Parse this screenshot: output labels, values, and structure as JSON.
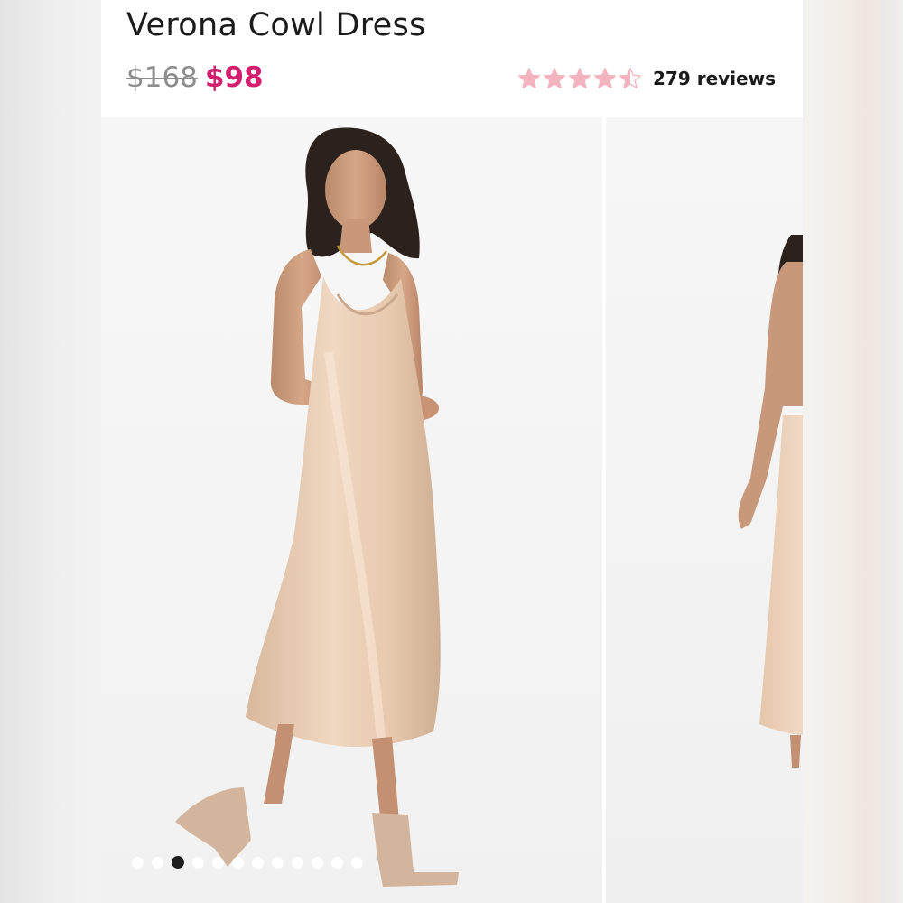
{
  "product": {
    "title": "Verona Cowl Dress",
    "price_original": "$168",
    "price_sale": "$98",
    "rating_value": 4.5,
    "rating_max": 5,
    "reviews_label": "279 reviews"
  },
  "colors": {
    "sale_price": "#d21f6e",
    "star": "#f4b4bf",
    "dress": "#e9cdb4"
  },
  "gallery": {
    "slide_count": 12,
    "active_index": 2,
    "slides": [
      "model-front-photo",
      "model-back-photo"
    ]
  },
  "icons": {
    "star": "star-icon",
    "half_star": "half-star-icon"
  }
}
